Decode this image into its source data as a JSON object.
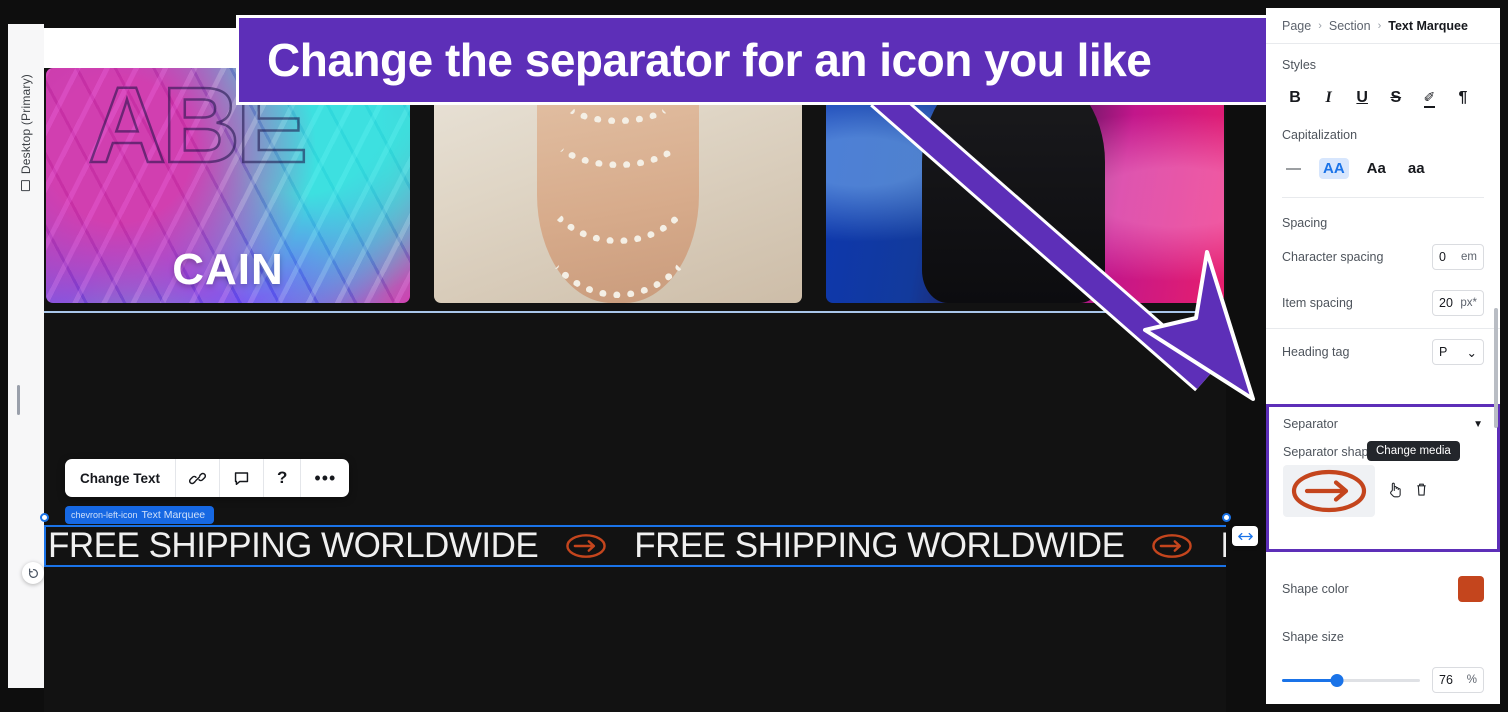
{
  "left_rail": {
    "device_label": "Desktop (Primary)",
    "device_icon": "monitor-icon",
    "undo_icon": "undo-circular-arrow-icon"
  },
  "callout": {
    "text": "Change the separator for an icon you like",
    "background": "#5d2fb8",
    "text_color": "#ffffff",
    "arrow_color": "#5d2fb8"
  },
  "canvas": {
    "gallery": [
      {
        "name": "image-cain",
        "caption": "CAIN",
        "ghost_text": "ABE"
      },
      {
        "name": "image-pearls",
        "caption": ""
      },
      {
        "name": "image-neon-figure",
        "caption": ""
      },
      {
        "name": "image-teal-partial",
        "caption": ""
      }
    ],
    "element_toolbar": {
      "change_text_label": "Change Text",
      "link_icon": "link-icon",
      "comment_icon": "comment-icon",
      "help_icon": "help-question-icon",
      "more_icon": "more-ellipsis-icon"
    },
    "element_tag": "Text Marquee",
    "element_tag_back_icon": "chevron-left-icon",
    "marquee": {
      "text": "FREE SHIPPING WORLDWIDE",
      "separator_icon": "circled-arrow-right-icon",
      "separator_color": "#c4451d",
      "selection_color": "#1a73e8",
      "repeat_count": 3
    },
    "resize_handle_icon": "horizontal-resize-icon"
  },
  "panel": {
    "breadcrumb": {
      "level1": "Page",
      "level2": "Section",
      "level3": "Text Marquee",
      "separator": "›"
    },
    "styles": {
      "title": "Styles",
      "buttons": [
        {
          "name": "bold-button",
          "glyph": "B"
        },
        {
          "name": "italic-button",
          "glyph": "I"
        },
        {
          "name": "underline-button",
          "glyph": "U"
        },
        {
          "name": "strikethrough-button",
          "glyph": "S"
        },
        {
          "name": "highlight-button",
          "glyph": "✐"
        },
        {
          "name": "paragraph-button",
          "glyph": "¶"
        }
      ]
    },
    "capitalization": {
      "title": "Capitalization",
      "options": [
        {
          "label": "—",
          "active": false
        },
        {
          "label": "AA",
          "active": true
        },
        {
          "label": "Aa",
          "active": false
        },
        {
          "label": "aa",
          "active": false
        }
      ]
    },
    "spacing": {
      "title": "Spacing",
      "character_spacing": {
        "label": "Character spacing",
        "value": "0",
        "unit": "em"
      },
      "item_spacing": {
        "label": "Item spacing",
        "value": "20",
        "unit": "px*"
      }
    },
    "heading_tag": {
      "label": "Heading tag",
      "value": "P",
      "caret": "⌄"
    },
    "separator": {
      "title": "Separator",
      "collapse_caret": "▼",
      "shape_label": "Separator shape",
      "shape_icon": "circled-arrow-right-icon",
      "shape_icon_color": "#c4451d",
      "tooltip": "Change media",
      "change_media_icon": "pointer-hand-icon",
      "delete_icon": "trash-icon",
      "highlight_color": "#5d2fb8"
    },
    "shape_color": {
      "label": "Shape color",
      "value": "#c4451d"
    },
    "shape_size": {
      "label": "Shape size",
      "value": "76",
      "unit": "%",
      "percent": 76
    }
  }
}
